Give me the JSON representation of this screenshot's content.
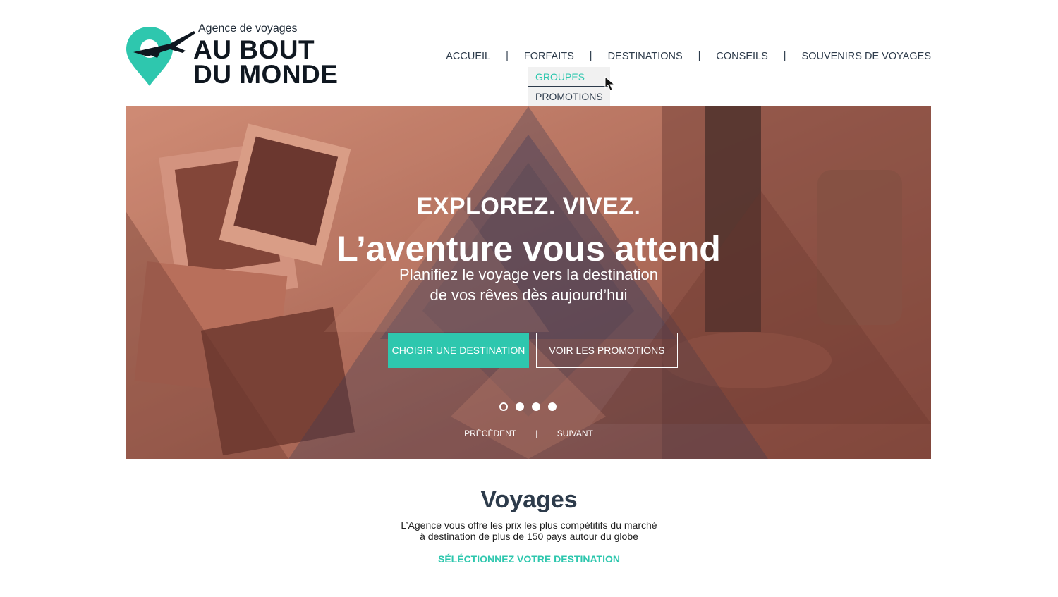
{
  "brand": {
    "tagline": "Agence de voyages",
    "name_line1": "AU BOUT",
    "name_line2": "DU MONDE",
    "accent_color": "#2ec7ae",
    "text_color": "#2d3b4b"
  },
  "nav": {
    "items": [
      "ACCUEIL",
      "FORFAITS",
      "DESTINATIONS",
      "CONSEILS",
      "SOUVENIRS DE VOYAGES"
    ],
    "separator": "|",
    "dropdown": {
      "parent": "FORFAITS",
      "items": [
        "GROUPES",
        "PROMOTIONS"
      ],
      "highlighted": "GROUPES"
    }
  },
  "hero": {
    "kicker": "EXPLOREZ. VIVEZ.",
    "headline": "L’aventure vous attend",
    "subtitle_line1": "Planifiez le voyage vers la destination",
    "subtitle_line2": "de vos rêves dès aujourd’hui",
    "primary_button": "CHOISIR UNE DESTINATION",
    "secondary_button": "VOIR LES PROMOTIONS",
    "slides": {
      "count": 4,
      "active_index": 0
    },
    "prev_label": "PRÉCÉDENT",
    "next_label": "SUIVANT",
    "pager_separator": "|"
  },
  "section": {
    "title": "Voyages",
    "desc_line1": "L’Agence vous offre les prix les plus compétitifs du marché",
    "desc_line2": "à destination de plus de 150 pays autour du globe",
    "cta": "SÉLÉCTIONNEZ VOTRE DESTINATION"
  }
}
